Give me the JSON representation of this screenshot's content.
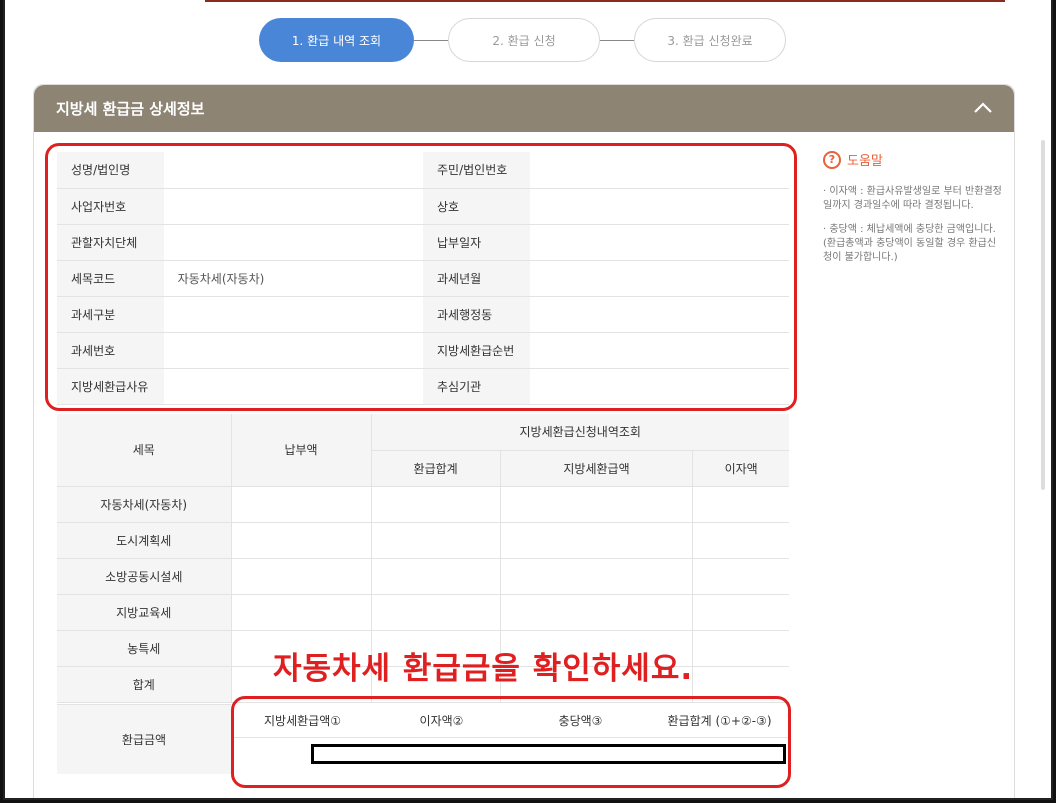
{
  "stepper": {
    "step1": "1. 환급 내역 조회",
    "step2": "2. 환급 신청",
    "step3": "3. 환급 신청완료"
  },
  "panel": {
    "title": "지방세 환급금 상세정보"
  },
  "info": {
    "r1": [
      "성명/법인명",
      "",
      "주민/법인번호",
      ""
    ],
    "r2": [
      "사업자번호",
      "",
      "상호",
      ""
    ],
    "r3": [
      "관할자치단체",
      "",
      "납부일자",
      ""
    ],
    "r4": [
      "세목코드",
      "자동차세(자동차)",
      "과세년월",
      ""
    ],
    "r5": [
      "과세구분",
      "",
      "과세행정동",
      ""
    ],
    "r6": [
      "과세번호",
      "",
      "지방세환급순번",
      ""
    ],
    "r7": [
      "지방세환급사유",
      "",
      "추심기관",
      ""
    ]
  },
  "sum": {
    "h_semok": "세목",
    "h_paid": "납부액",
    "h_group": "지방세환급신청내역조회",
    "h_total": "환급합계",
    "h_local": "지방세환급액",
    "h_interest": "이자액",
    "rows": [
      "자동차세(자동차)",
      "도시계획세",
      "소방공동시설세",
      "지방교육세",
      "농특세",
      "합계"
    ]
  },
  "refund": {
    "label": "환급금액",
    "c1": "지방세환급액①",
    "c2": "이자액②",
    "c3": "충당액③",
    "c4": "환급합계 (①+②-③)"
  },
  "help": {
    "title": "도움말",
    "item1": "· 이자액 : 환급사유발생일로 부터 반환결정일까지 경과일수에 따라 결정됩니다.",
    "item2": "· 충당액 : 체납세액에 충당한 금액입니다. (환급총액과 충당액이 동일할 경우 환급신청이 불가합니다.)"
  },
  "annotation": {
    "text": "자동차세 환급금을 확인하세요."
  },
  "colors": {
    "accent": "#4a86d8",
    "header": "#8d8474",
    "annotation": "#e02020",
    "help": "#e8613a"
  }
}
